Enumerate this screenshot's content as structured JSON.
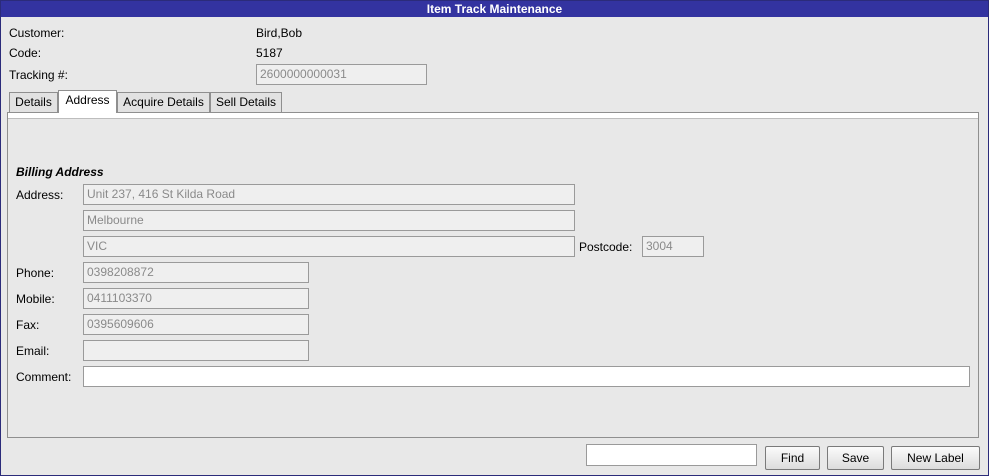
{
  "window": {
    "title": "Item Track Maintenance"
  },
  "header": {
    "customer_label": "Customer:",
    "customer_value": "Bird,Bob",
    "code_label": "Code:",
    "code_value": "5187",
    "tracking_label": "Tracking #:",
    "tracking_value": "2600000000031"
  },
  "tabs": [
    {
      "label": "Details",
      "active": false
    },
    {
      "label": "Address",
      "active": true
    },
    {
      "label": "Acquire Details",
      "active": false
    },
    {
      "label": "Sell Details",
      "active": false
    }
  ],
  "billing": {
    "section_title": "Billing Address",
    "address_label": "Address:",
    "address_line1": "Unit 237, 416 St Kilda Road",
    "address_line2": "Melbourne",
    "address_line3": "VIC",
    "postcode_label": "Postcode:",
    "postcode_value": "3004",
    "phone_label": "Phone:",
    "phone_value": "0398208872",
    "mobile_label": "Mobile:",
    "mobile_value": "0411103370",
    "fax_label": "Fax:",
    "fax_value": "0395609606",
    "email_label": "Email:",
    "email_value": "",
    "comment_label": "Comment:",
    "comment_value": ""
  },
  "footer": {
    "search_value": "",
    "find_label": "Find",
    "save_label": "Save",
    "new_label_label": "New Label"
  }
}
